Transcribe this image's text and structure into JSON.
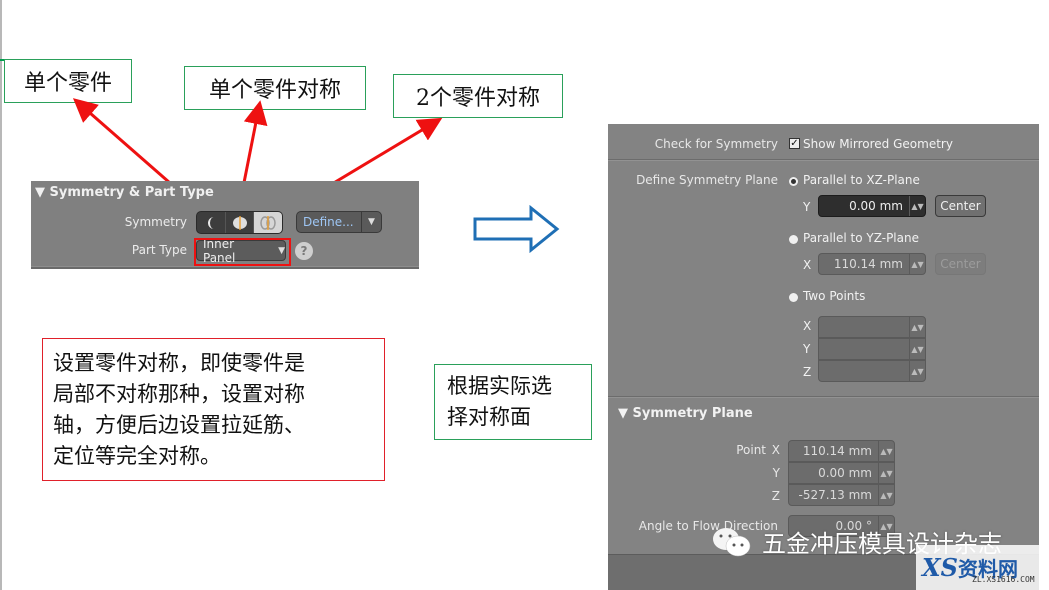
{
  "callouts": {
    "single_part": "单个零件",
    "single_part_symmetric": "单个零件对称",
    "two_parts_symmetric": "2个零件对称",
    "note_left": [
      "设置零件对称，即使零件是",
      "局部不对称那种，设置对称",
      "轴，方便后边设置拉延筋、",
      "定位等完全对称。"
    ],
    "note_right": [
      "根据实际选",
      "择对称面"
    ]
  },
  "small_panel": {
    "header": "Symmetry & Part Type",
    "symmetry_label": "Symmetry",
    "symmetry_options": [
      "single-part-icon",
      "single-part-symmetric-icon",
      "two-parts-symmetric-icon"
    ],
    "symmetry_selected_index": 2,
    "define_label": "Define...",
    "part_type_label": "Part Type",
    "part_type_value": "Inner Panel",
    "help_label": "?"
  },
  "big_panel": {
    "check_for_symmetry_label": "Check for Symmetry",
    "show_mirrored_label": "Show Mirrored Geometry",
    "show_mirrored_checked": true,
    "define_plane_label": "Define Symmetry Plane",
    "option_xz": "Parallel to XZ-Plane",
    "xz_axis": "Y",
    "xz_value": "0.00 mm",
    "center_label": "Center",
    "option_yz": "Parallel to YZ-Plane",
    "yz_axis": "X",
    "yz_value": "110.14 mm",
    "option_two_points": "Two Points",
    "tp_axes": [
      "X",
      "Y",
      "Z"
    ],
    "selected_option": "Parallel to XZ-Plane",
    "section_header": "Symmetry Plane",
    "point_label": "Point",
    "point_axes": [
      "X",
      "Y",
      "Z"
    ],
    "point_values": [
      "110.14 mm",
      "0.00 mm",
      "-527.13 mm"
    ],
    "angle_label": "Angle to Flow Direction",
    "angle_value": "0.00 °"
  },
  "watermark": {
    "text": "五金冲压模具设计杂志",
    "logo_xs": "XS",
    "logo_cn": "资料网",
    "logo_url": "ZL.XS1616.COM"
  },
  "colors": {
    "callout_border_green": "#2aa05a",
    "callout_border_red": "#e0202a",
    "arrow_red": "#ee1111",
    "big_arrow_blue": "#1f6fb5",
    "panel_grey": "#838383"
  }
}
